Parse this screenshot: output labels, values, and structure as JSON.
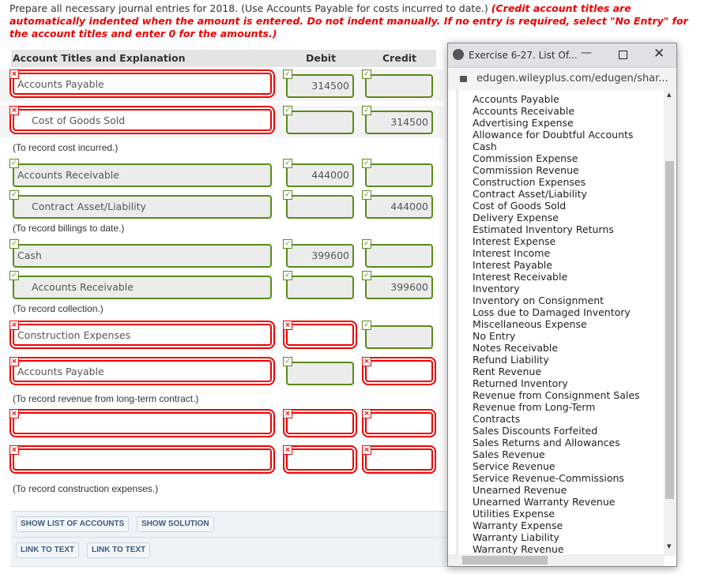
{
  "intro": {
    "text": "Prepare all necessary journal entries for 2018. (Use Accounts Payable for costs incurred to date.)",
    "warning": "(Credit account titles are automatically indented when the amount is entered. Do not indent manually. If no entry is required, select \"No Entry\" for the account titles and enter 0 for the amounts.)"
  },
  "table": {
    "col_account": "Account Titles and Explanation",
    "col_debit": "Debit",
    "col_credit": "Credit"
  },
  "entries": [
    {
      "rows": [
        {
          "account": "Accounts Payable",
          "indent": false,
          "debit": "314500",
          "credit": "",
          "status": [
            "bad",
            "ok",
            "ok"
          ]
        },
        {
          "account": "Cost of Goods Sold",
          "indent": true,
          "debit": "",
          "credit": "314500",
          "status": [
            "bad",
            "ok",
            "ok"
          ]
        }
      ],
      "note": "(To record cost incurred.)"
    },
    {
      "rows": [
        {
          "account": "Accounts Receivable",
          "indent": false,
          "debit": "444000",
          "credit": "",
          "status": [
            "ok",
            "ok",
            "ok"
          ]
        },
        {
          "account": "Contract Asset/Liability",
          "indent": true,
          "debit": "",
          "credit": "444000",
          "status": [
            "ok",
            "ok",
            "ok"
          ]
        }
      ],
      "note": "(To record billings to date.)"
    },
    {
      "rows": [
        {
          "account": "Cash",
          "indent": false,
          "debit": "399600",
          "credit": "",
          "status": [
            "ok",
            "ok",
            "ok"
          ]
        },
        {
          "account": "Accounts Receivable",
          "indent": true,
          "debit": "",
          "credit": "399600",
          "status": [
            "ok",
            "ok",
            "ok"
          ]
        }
      ],
      "note": "(To record collection.)"
    },
    {
      "rows": [
        {
          "account": "Construction Expenses",
          "indent": false,
          "debit": "",
          "credit": "",
          "status": [
            "bad",
            "bad",
            "ok"
          ]
        },
        {
          "account": "Accounts Payable",
          "indent": false,
          "debit": "",
          "credit": "",
          "status": [
            "bad",
            "ok",
            "bad"
          ]
        }
      ],
      "note": "(To record revenue from long-term contract.)"
    },
    {
      "rows": [
        {
          "account": "",
          "indent": false,
          "debit": "",
          "credit": "",
          "status": [
            "bad",
            "bad",
            "bad"
          ]
        },
        {
          "account": "",
          "indent": false,
          "debit": "",
          "credit": "",
          "status": [
            "bad",
            "bad",
            "bad"
          ]
        }
      ],
      "note": "(To record construction expenses.)"
    }
  ],
  "buttons": {
    "show_list": "SHOW LIST OF ACCOUNTS",
    "show_solution": "SHOW SOLUTION",
    "link1": "LINK TO TEXT",
    "link2": "LINK TO TEXT"
  },
  "popup": {
    "title": "Exercise 6-27. List Of...",
    "url": "edugen.wileyplus.com/edugen/shar...",
    "accounts": [
      "Accounts Payable",
      "Accounts Receivable",
      "Advertising Expense",
      "Allowance for Doubtful Accounts",
      "Cash",
      "Commission Expense",
      "Commission Revenue",
      "Construction Expenses",
      "Contract Asset/Liability",
      "Cost of Goods Sold",
      "Delivery Expense",
      "Estimated Inventory Returns",
      "Interest Expense",
      "Interest Income",
      "Interest Payable",
      "Interest Receivable",
      "Inventory",
      "Inventory on Consignment",
      "Loss due to Damaged Inventory",
      "Miscellaneous Expense",
      "No Entry",
      "Notes Receivable",
      "Refund Liability",
      "Rent Revenue",
      "Returned Inventory",
      "Revenue from Consignment Sales",
      "Revenue from Long-Term",
      "Contracts",
      "Sales Discounts Forfeited",
      "Sales Returns and Allowances",
      "Sales Revenue",
      "Service Revenue",
      "Service Revenue-Commissions",
      "Unearned Revenue",
      "Unearned Warranty Revenue",
      "Utilities Expense",
      "Warranty Expense",
      "Warranty Liability",
      "Warranty Revenue"
    ]
  }
}
